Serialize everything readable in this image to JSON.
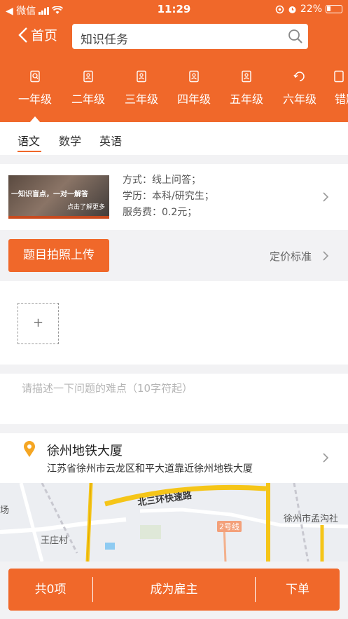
{
  "status_bar": {
    "back_app": "◀ 微信",
    "time": "11:29",
    "battery": "22%"
  },
  "nav": {
    "back_label": "首页",
    "search_value": "知识任务"
  },
  "grades": [
    {
      "label": "一年级",
      "active": true
    },
    {
      "label": "二年级",
      "active": false
    },
    {
      "label": "三年级",
      "active": false
    },
    {
      "label": "四年级",
      "active": false
    },
    {
      "label": "五年级",
      "active": false
    },
    {
      "label": "六年级",
      "active": false
    },
    {
      "label": "错题",
      "active": false
    }
  ],
  "subjects": [
    {
      "label": "语文",
      "active": true
    },
    {
      "label": "数学",
      "active": false
    },
    {
      "label": "英语",
      "active": false
    }
  ],
  "service": {
    "banner_text": "一知识盲点，一对一解答",
    "banner_sub": "点击了解更多",
    "method": "方式：线上问答；",
    "education": "学历：本科/研究生；",
    "fee": "服务费：0.2元；"
  },
  "upload": {
    "button_label": "题目拍照上传",
    "pricing_label": "定价标准"
  },
  "photos": {
    "add_symbol": "+"
  },
  "description": {
    "placeholder": "请描述一下问题的难点（10字符起）"
  },
  "location": {
    "name": "徐州地铁大厦",
    "address": "江苏省徐州市云龙区和平大道靠近徐州地铁大厦"
  },
  "map": {
    "labels": [
      "北三环快速路",
      "2号线",
      "徐州市孟沟社",
      "王庄村",
      "场"
    ]
  },
  "bottom_bar": {
    "count_label": "共0项",
    "employer_label": "成为雇主",
    "order_label": "下单"
  },
  "colors": {
    "accent": "#f0682a",
    "background": "#f2f2f4"
  }
}
